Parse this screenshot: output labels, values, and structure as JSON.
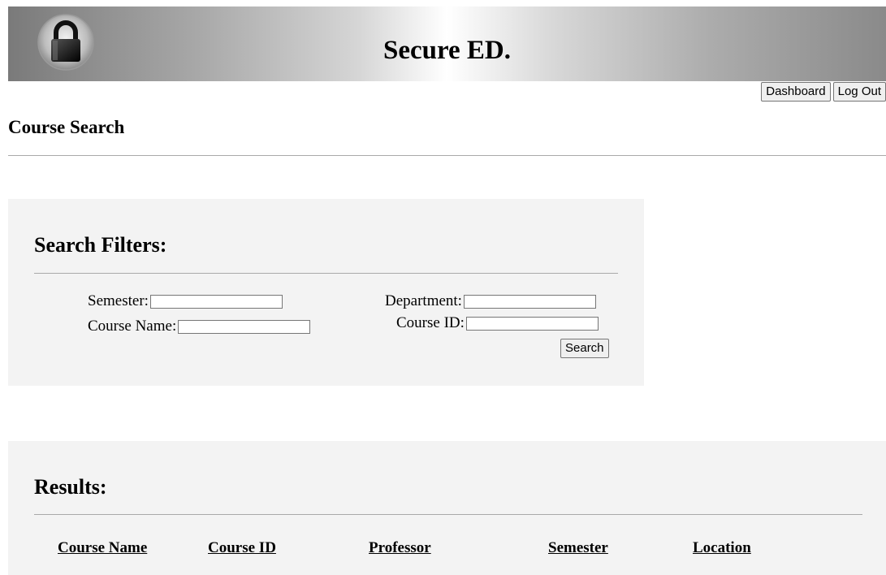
{
  "header": {
    "site_title": "Secure ED."
  },
  "nav": {
    "dashboard_label": "Dashboard",
    "logout_label": "Log Out"
  },
  "page": {
    "heading": "Course Search"
  },
  "filters": {
    "title": "Search Filters:",
    "semester_label": "Semester:",
    "course_name_label": "Course Name:",
    "department_label": "Department:",
    "course_id_label": "Course ID:",
    "semester_value": "",
    "course_name_value": "",
    "department_value": "",
    "course_id_value": "",
    "search_label": "Search"
  },
  "results": {
    "title": "Results:",
    "columns": [
      "Course Name",
      "Course ID",
      "Professor",
      "Semester",
      "Location"
    ]
  },
  "colors": {
    "panel_bg": "#f3f3f3",
    "divider": "#a9a9a9"
  },
  "icons": {
    "logo": "padlock-icon"
  }
}
